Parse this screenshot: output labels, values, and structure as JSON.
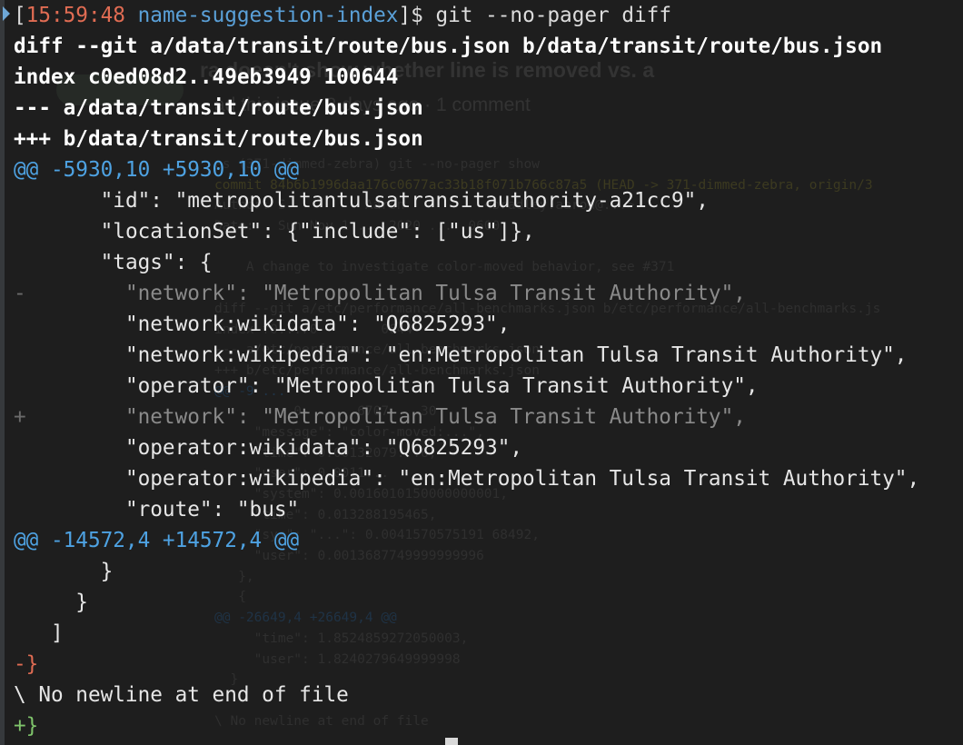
{
  "prompt": {
    "open_bracket": "[",
    "time": "15:59:48",
    "repo": "name-suggestion-index",
    "close": "]$ ",
    "command": "git --no-pager diff"
  },
  "diff_header": [
    "diff --git a/data/transit/route/bus.json b/data/transit/route/bus.json",
    "index c0ed08d2..49eb3949 100644",
    "--- a/data/transit/route/bus.json",
    "+++ b/data/transit/route/bus.json"
  ],
  "hunks": [
    "@@ -5930,10 +5930,10 @@",
    "@@ -14572,4 +14572,4 @@"
  ],
  "body": [
    {
      "prefix": " ",
      "text": "      \"id\": \"metropolitantulsatransitauthority-a21cc9\",",
      "kind": "context"
    },
    {
      "prefix": " ",
      "text": "      \"locationSet\": {\"include\": [\"us\"]},",
      "kind": "context"
    },
    {
      "prefix": " ",
      "text": "      \"tags\": {",
      "kind": "context"
    },
    {
      "prefix": "-",
      "text": "        \"network\": \"Metropolitan Tulsa Transit Authority\",",
      "kind": "removed"
    },
    {
      "prefix": " ",
      "text": "        \"network:wikidata\": \"Q6825293\",",
      "kind": "context"
    },
    {
      "prefix": " ",
      "text": "        \"network:wikipedia\": \"en:Metropolitan Tulsa Transit Authority\",",
      "kind": "context"
    },
    {
      "prefix": " ",
      "text": "        \"operator\": \"Metropolitan Tulsa Transit Authority\",",
      "kind": "context"
    },
    {
      "prefix": "+",
      "text": "        \"network\": \"Metropolitan Tulsa Transit Authority\",",
      "kind": "added"
    },
    {
      "prefix": " ",
      "text": "        \"operator:wikidata\": \"Q6825293\",",
      "kind": "context"
    },
    {
      "prefix": " ",
      "text": "        \"operator:wikipedia\": \"en:Metropolitan Tulsa Transit Authority\",",
      "kind": "context"
    },
    {
      "prefix": " ",
      "text": "        \"route\": \"bus\"",
      "kind": "context"
    }
  ],
  "tail": [
    {
      "text": "       }",
      "kind": "context"
    },
    {
      "text": "     }",
      "kind": "context"
    },
    {
      "text": "   ]",
      "kind": "context"
    },
    {
      "text": "-}",
      "kind": "removed-brace"
    },
    {
      "text": "\\ No newline at end of file",
      "kind": "context"
    },
    {
      "text": "+}",
      "kind": "added-brace"
    }
  ],
  "background_window": {
    "title": "ra doesn't show whether line is removed vs. a",
    "subtitle": "ad this issue 2 days ago · 1 comment",
    "code": [
      "es (371-dimmed-zebra) git --no-pager show",
      "commit 84b6b1996daa176c0677ac33b18f071b766c87a5 (HEAD -> 371-dimmed-zebra, origin/3",
      "Author: S          Aaron          <bradley.aaron@...>",
      "Date:   Sun Nov 1 ... 2020 ...  0600",
      "",
      "    A change to investigate color-moved behavior, see #371",
      "",
      "diff --git a/etc/performance/all-benchmarks.json b/etc/performance/all-benchmarks.js",
      "index f0...70        0644",
      "--- a/etc/performance/all-benchmarks.json",
      "+++ b/etc/performance/all-benchmarks.json",
      "@@ -9 ...",
      "          0-      6707    30",
      "     \"message\": \"color-moved:...\",",
      "     \"time\": 0.00132079...6,",
      "     \"user\": 0.0011...",
      "     \"system\": 0.0016010150000000001,",
      "     \"time\": 0.013288195465,",
      "     \"sys\": \"...\": 0.0041570575191 68492,",
      "     \"user\": 0.0013687749999999996",
      "   },",
      "   {",
      "@@ -26649,4 +26649,4 @@",
      "     \"time\": 1.8524859272050003,",
      "     \"user\": 1.8240279649999998",
      "  }",
      "",
      "\\ No newline at end of file"
    ]
  }
}
